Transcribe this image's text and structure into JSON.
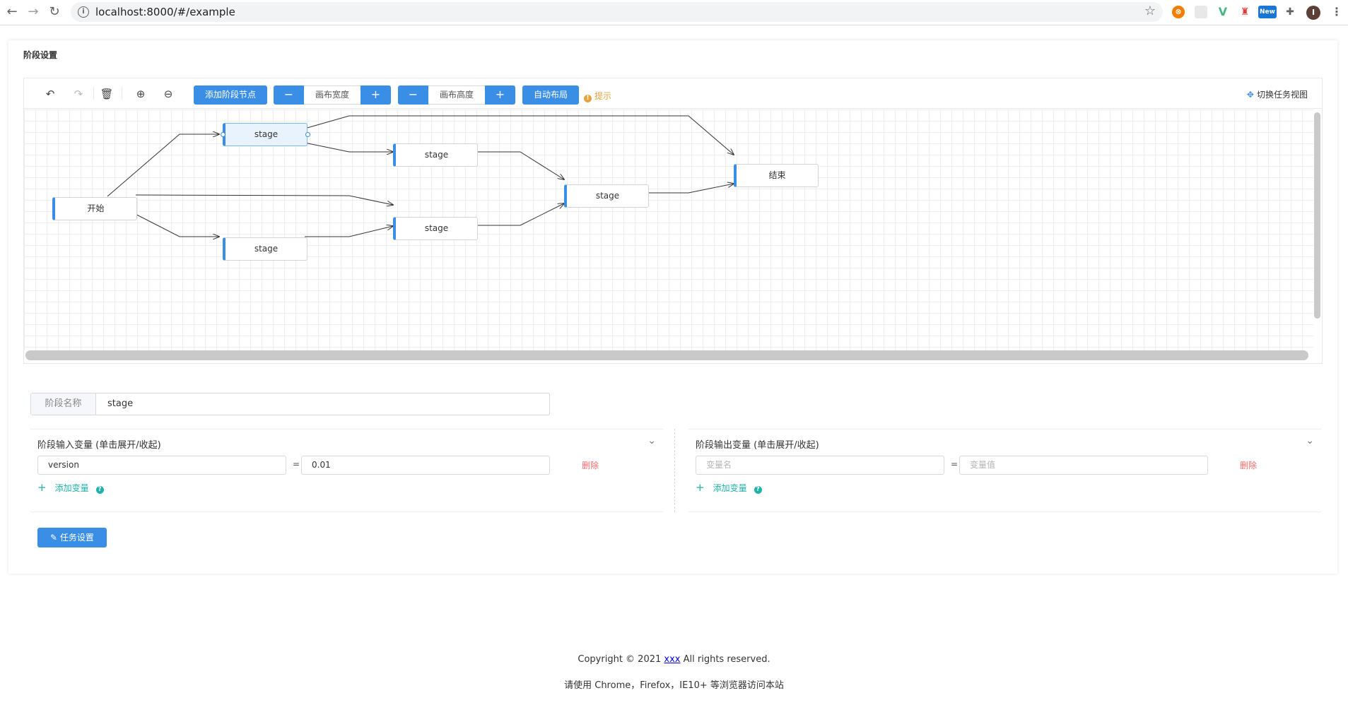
{
  "browser": {
    "url": "localhost:8000/#/example",
    "ext_new_badge": "New",
    "avatar_letter": "I"
  },
  "page": {
    "section_title": "阶段设置"
  },
  "toolbar": {
    "add_stage_node": "添加阶段节点",
    "minus": "−",
    "plus": "+",
    "canvas_width": "画布宽度",
    "canvas_height": "画布高度",
    "auto_layout": "自动布局",
    "hint": "提示",
    "switch_task_view": "切换任务视图"
  },
  "graph": {
    "nodes": [
      {
        "id": "start",
        "label": "开始"
      },
      {
        "id": "s1",
        "label": "stage",
        "selected": true
      },
      {
        "id": "s2",
        "label": "stage"
      },
      {
        "id": "s3",
        "label": "stage"
      },
      {
        "id": "s4",
        "label": "stage"
      },
      {
        "id": "s5",
        "label": "stage"
      },
      {
        "id": "end",
        "label": "结束"
      }
    ],
    "edges": [
      [
        "start",
        "s1"
      ],
      [
        "start",
        "s4"
      ],
      [
        "start",
        "s3"
      ],
      [
        "s1",
        "s2"
      ],
      [
        "s1",
        "end"
      ],
      [
        "s2",
        "s5"
      ],
      [
        "s4",
        "s3"
      ],
      [
        "s3",
        "s5"
      ],
      [
        "s5",
        "end"
      ]
    ]
  },
  "form": {
    "stage_name_label": "阶段名称",
    "stage_name_value": "stage",
    "input_panel": {
      "title": "阶段输入变量 (单击展开/收起)",
      "name_value": "version",
      "eq": "=",
      "value_value": "0.01",
      "delete": "删除",
      "add_var": "添加变量"
    },
    "output_panel": {
      "title": "阶段输出变量 (单击展开/收起)",
      "name_placeholder": "变量名",
      "eq": "=",
      "value_placeholder": "变量值",
      "delete": "删除",
      "add_var": "添加变量"
    },
    "task_settings_button": "任务设置"
  },
  "footer": {
    "copyright_prefix": "Copyright © 2021 ",
    "copyright_link": "xxx",
    "copyright_suffix": " All rights reserved.",
    "browser_note": "请使用 Chrome，Firefox，IE10+ 等浏览器访问本站"
  },
  "colors": {
    "primary": "#3a8ee6",
    "warning": "#e6a23c",
    "danger": "#f56c6c",
    "teal": "#20b2aa"
  }
}
